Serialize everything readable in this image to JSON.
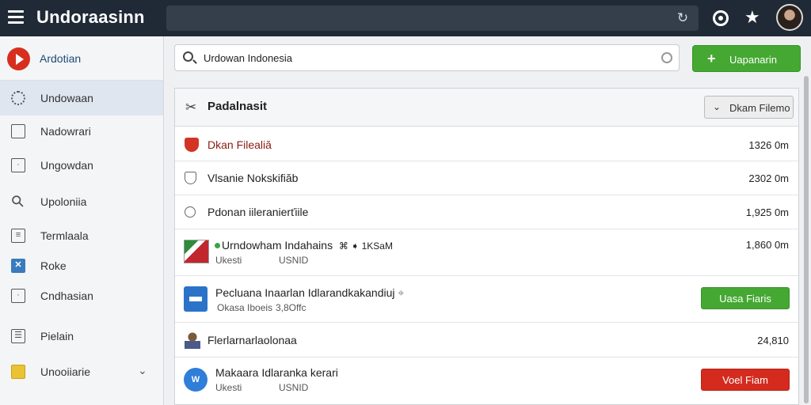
{
  "app": {
    "title": "Undoraasinn"
  },
  "sidebar": {
    "brand": "Ardotian",
    "items": [
      {
        "label": "Undowaan",
        "icon": "gear-icon"
      },
      {
        "label": "Nadowrari",
        "icon": "square-icon"
      },
      {
        "label": "Ungowdan",
        "icon": "frame-icon"
      },
      {
        "label": "Upoloniia",
        "icon": "wrench-icon"
      },
      {
        "label": "Termlaala",
        "icon": "list-icon"
      },
      {
        "label": "Roke",
        "icon": "x-box-icon"
      },
      {
        "label": "Cndhasian",
        "icon": "frame-icon"
      },
      {
        "label": "Pielain",
        "icon": "table-icon"
      },
      {
        "label": "Unooiiarie",
        "icon": "grid-icon"
      }
    ]
  },
  "search": {
    "value": "Urdowan Indonesia"
  },
  "actions": {
    "primary_label": "Uapanarin"
  },
  "panel": {
    "title": "Padalnasit",
    "dropdown_label": "Dkam Filemo",
    "rows": [
      {
        "title": "Dkan Filealiă",
        "value": "1326 0m",
        "icon": "shield-icon",
        "accent": "#8b1a10"
      },
      {
        "title": "Vlsanie Nokskifiăb",
        "value": "2302 0m",
        "icon": "shield-outline-icon"
      },
      {
        "title": "Pdonan iileranierťiile",
        "value": "1,925 0m",
        "icon": "circle-icon"
      },
      {
        "title": "Urndowham Indahains",
        "extra": "⌘ ➧ 1KSaM",
        "sub1": "Ukesti",
        "sub2": "USNID",
        "value": "1,860 0m",
        "icon": "flag-icon"
      },
      {
        "title": "Pecluana Inaarlan Idlarandkakandiuj",
        "sub1": "Okasa Iboeis",
        "sub2": "3,8Offc",
        "button": "Uasa Fiaris",
        "icon": "document-icon"
      },
      {
        "title": "Flerlarnarlaolonaa",
        "value": "24,810",
        "icon": "person-icon"
      },
      {
        "title": "Makaara Idlaranka kerari",
        "sub1": "Ukesti",
        "sub2": "USNID",
        "button": "Voel Fiam",
        "icon": "blue-circle-icon",
        "icon_text": "W"
      }
    ]
  },
  "colors": {
    "topbar": "#1f2a36",
    "primary": "#45a832",
    "danger": "#d42b1e",
    "brand": "#d72f1f"
  }
}
